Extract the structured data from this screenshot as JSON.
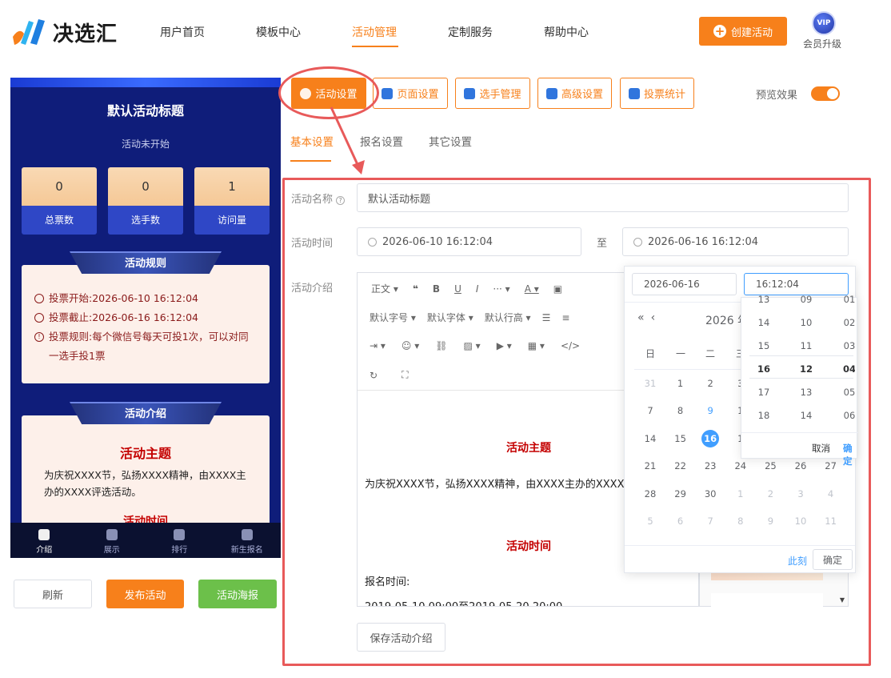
{
  "brand": {
    "name": "决选汇"
  },
  "nav": {
    "items": [
      "用户首页",
      "模板中心",
      "活动管理",
      "定制服务",
      "帮助中心"
    ],
    "active": "活动管理"
  },
  "header": {
    "create_btn": "创建活动",
    "vip_badge": "VIP",
    "vip_label": "会员升级"
  },
  "preview": {
    "title": "默认活动标题",
    "status": "活动未开始",
    "stats": [
      {
        "value": "0",
        "label": "总票数"
      },
      {
        "value": "0",
        "label": "选手数"
      },
      {
        "value": "1",
        "label": "访问量"
      }
    ],
    "rules_heading": "活动规则",
    "rules": [
      {
        "label": "投票开始:",
        "text": "2026-06-10 16:12:04"
      },
      {
        "label": "投票截止:",
        "text": "2026-06-16 16:12:04"
      },
      {
        "label": "投票规则:",
        "text": "每个微信号每天可投1次，可以对同一选手投1票"
      }
    ],
    "intro_heading": "活动介绍",
    "intro_title": "活动主题",
    "intro_text": "为庆祝XXXX节，弘扬XXXX精神，由XXXX主办的XXXX评选活动。",
    "intro_next": "活动时间",
    "bottom_tabs": [
      "介绍",
      "展示",
      "排行",
      "新生报名"
    ]
  },
  "actions": {
    "refresh": "刷新",
    "publish": "发布活动",
    "poster": "活动海报"
  },
  "toolbar": {
    "tabs": [
      "活动设置",
      "页面设置",
      "选手管理",
      "高级设置",
      "投票统计"
    ],
    "active": "活动设置",
    "preview_label": "预览效果"
  },
  "subtabs": {
    "items": [
      "基本设置",
      "报名设置",
      "其它设置"
    ],
    "active": "基本设置"
  },
  "form": {
    "name_label": "活动名称",
    "name_value": "默认活动标题",
    "time_label": "活动时间",
    "start": "2026-06-10 16:12:04",
    "to": "至",
    "end": "2026-06-16 16:12:04",
    "intro_label": "活动介绍",
    "save_btn": "保存活动介绍"
  },
  "editor": {
    "para": "正文",
    "font_size": "默认字号",
    "font_family": "默认字体",
    "line_height": "默认行高",
    "h1": "活动主题",
    "p1": "为庆祝XXXX节，弘扬XXXX精神，由XXXX主办的XXXX评",
    "h2": "活动时间",
    "p2": "报名时间:",
    "p3": "2019-05-10 09:00至2019-05-20 20:00"
  },
  "picker": {
    "date_value": "2026-06-16",
    "time_value": "16:12:04",
    "year": "2026 年",
    "weekdays": [
      "日",
      "一",
      "二",
      "三"
    ],
    "days": [
      [
        "31",
        "1",
        "2",
        "3",
        "",
        "",
        ""
      ],
      [
        "7",
        "8",
        "9",
        "1",
        "",
        "",
        ""
      ],
      [
        "14",
        "15",
        "16",
        "1",
        "",
        "",
        ""
      ],
      [
        "21",
        "22",
        "23",
        "24",
        "25",
        "26",
        "27"
      ],
      [
        "28",
        "29",
        "30",
        "1",
        "2",
        "3",
        "4"
      ],
      [
        "5",
        "6",
        "7",
        "8",
        "9",
        "10",
        "11"
      ]
    ],
    "hours": [
      "13",
      "14",
      "15",
      "16",
      "17",
      "18"
    ],
    "minutes": [
      "09",
      "10",
      "11",
      "12",
      "13",
      "14"
    ],
    "seconds": [
      "01",
      "02",
      "03",
      "04",
      "05",
      "06"
    ],
    "time_cancel": "取消",
    "time_ok": "确定",
    "now": "此刻",
    "ok": "确定"
  }
}
